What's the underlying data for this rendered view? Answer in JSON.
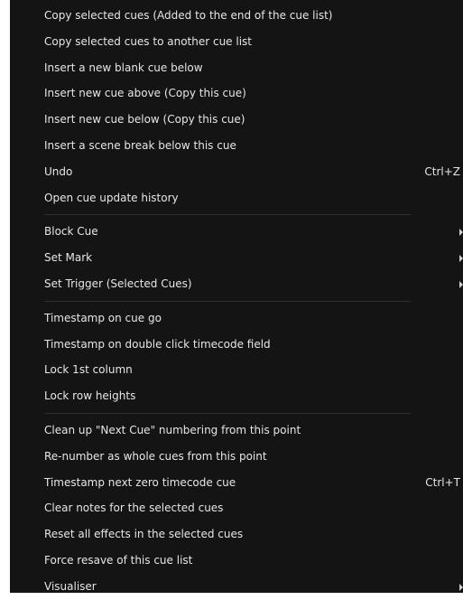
{
  "menu": {
    "items": [
      {
        "label": "Copy selected cues (Added to the end of the cue list)"
      },
      {
        "label": "Copy selected cues to another cue list"
      },
      {
        "label": "Insert a new blank cue below"
      },
      {
        "label": "Insert new cue above (Copy this cue)"
      },
      {
        "label": "Insert new cue below (Copy this cue)"
      },
      {
        "label": "Insert a scene break below this cue"
      },
      {
        "label": "Undo",
        "shortcut": "Ctrl+Z"
      },
      {
        "label": "Open cue update history"
      },
      {
        "label": "Block Cue",
        "submenu": true
      },
      {
        "label": "Set Mark",
        "submenu": true
      },
      {
        "label": "Set Trigger (Selected Cues)",
        "submenu": true
      },
      {
        "label": "Timestamp on cue go"
      },
      {
        "label": "Timestamp on double click timecode field"
      },
      {
        "label": "Lock 1st column"
      },
      {
        "label": "Lock row heights"
      },
      {
        "label": "Clean up \"Next Cue\" numbering from this point"
      },
      {
        "label": "Re-number as whole cues from this point"
      },
      {
        "label": "Timestamp next zero timecode cue",
        "shortcut": "Ctrl+T"
      },
      {
        "label": "Clear notes for the selected cues"
      },
      {
        "label": "Reset all effects in the selected cues"
      },
      {
        "label": "Force resave of this cue list"
      },
      {
        "label": "Visualiser",
        "submenu": true
      }
    ]
  },
  "colors": {
    "menu_background": "#141414",
    "text": "#e6e6e6",
    "separator": "#2e2e2e"
  }
}
